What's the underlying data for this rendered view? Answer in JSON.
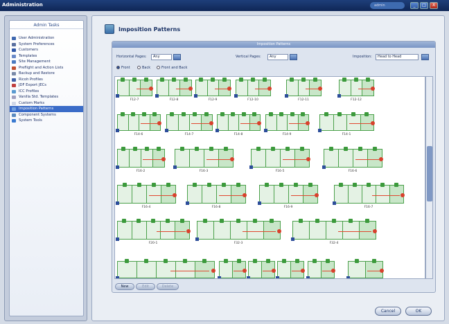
{
  "window": {
    "title": "Administration",
    "user": "admin",
    "controls": [
      "_",
      "□",
      "X"
    ]
  },
  "sidebar": {
    "header": "Admin Tasks",
    "selected": 13,
    "items": [
      {
        "label": "User Administration",
        "color": "#4068b0"
      },
      {
        "label": "System Preferences",
        "color": "#5a70a0"
      },
      {
        "label": "Customers",
        "color": "#3058a8"
      },
      {
        "label": "Templates",
        "color": "#6a8ac8"
      },
      {
        "label": "Site Management",
        "color": "#4a7ac0"
      },
      {
        "label": "Preflight and Action Lists",
        "color": "#c05030"
      },
      {
        "label": "Backup and Restore",
        "color": "#7a8aa8"
      },
      {
        "label": "Ricoh Profiles",
        "color": "#4060a8"
      },
      {
        "label": "JDF Export JECs",
        "color": "#c04040"
      },
      {
        "label": "ICC Profiles",
        "color": "#5a9ad0"
      },
      {
        "label": "Vanilla Std. Templates",
        "color": "#a0a0c0"
      },
      {
        "label": "Custom Marks",
        "color": "#d0d8e8"
      },
      {
        "label": "Imposition Patterns",
        "color": "#70a0e0"
      },
      {
        "label": "Component Systems",
        "color": "#5a8ac0"
      },
      {
        "label": "System Tools",
        "color": "#3a7ad0"
      }
    ]
  },
  "page": {
    "title": "Imposition Patterns"
  },
  "panel": {
    "bar": "Imposition Patterns",
    "horizontal_label": "Horizontal Pages:",
    "horizontal_value": "Any",
    "vertical_label": "Vertical Pages:",
    "vertical_value": "Any",
    "imposition_label": "Imposition:",
    "imposition_value": "Head to Head",
    "radios": [
      "Front",
      "Back",
      "Front and Back"
    ],
    "buttons": [
      "New",
      "Edit",
      "Delete"
    ]
  },
  "patterns": {
    "rows": [
      [
        "F12-7",
        "F12-8",
        "F12-9",
        "F12-10",
        "F12-11",
        "F12-12"
      ],
      [
        "F14-6",
        "F14-7",
        "F14-8",
        "F14-9",
        "F14-1"
      ],
      [
        "F16-2",
        "F16-3",
        "F16-5",
        "F16-6"
      ],
      [
        "F16-4",
        "F16-8",
        "F16-9",
        "F16-7"
      ],
      [
        "F20-1",
        "F32-3",
        "F32-4"
      ],
      [
        "",
        "",
        "",
        "",
        "",
        ""
      ]
    ]
  },
  "dialog": {
    "cancel": "Cancel",
    "ok": "OK"
  }
}
